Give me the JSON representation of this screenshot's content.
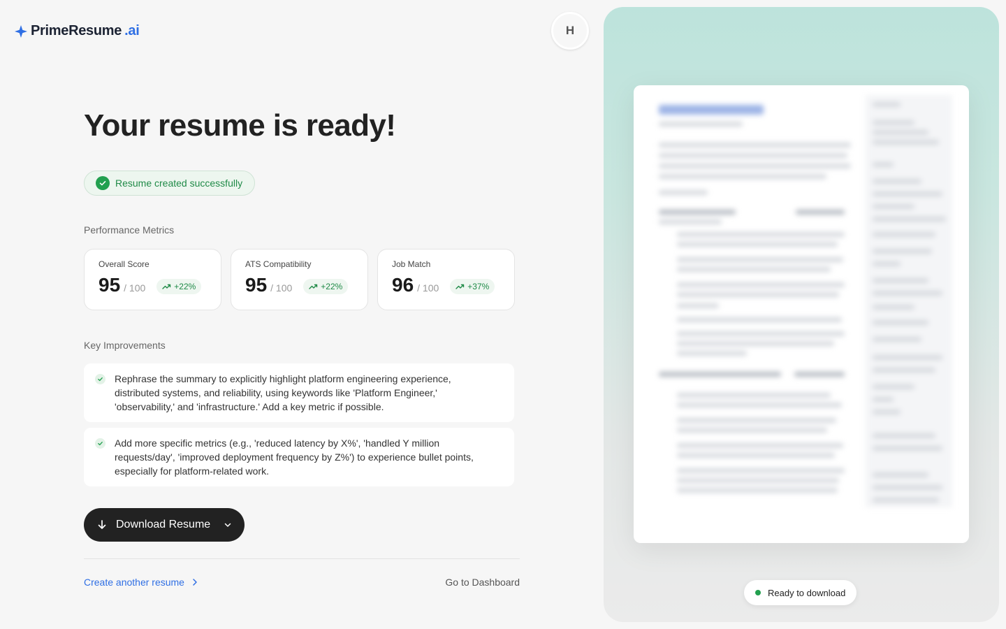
{
  "brand": {
    "name_main": "PrimeResume",
    "name_suffix": ".ai",
    "accent": "#2f6fe4"
  },
  "user": {
    "initial": "H"
  },
  "headline": "Your resume is ready!",
  "status": {
    "message": "Resume created successfully",
    "color": "#1f8a47"
  },
  "metrics_section": {
    "label": "Performance Metrics",
    "items": [
      {
        "name": "Overall Score",
        "value": "95",
        "max": "/ 100",
        "delta": "+22%"
      },
      {
        "name": "ATS Compatibility",
        "value": "95",
        "max": "/ 100",
        "delta": "+22%"
      },
      {
        "name": "Job Match",
        "value": "96",
        "max": "/ 100",
        "delta": "+37%"
      }
    ]
  },
  "improvements_section": {
    "label": "Key Improvements",
    "items": [
      "Rephrase the summary to explicitly highlight platform engineering experience, distributed systems, and reliability, using keywords like 'Platform Engineer,' 'observability,' and 'infrastructure.' Add a key metric if possible.",
      "Add more specific metrics (e.g., 'reduced latency by X%', 'handled Y million requests/day', 'improved deployment frequency by Z%') to experience bullet points, especially for platform-related work."
    ]
  },
  "actions": {
    "download_label": "Download Resume",
    "create_another": "Create another resume",
    "dashboard": "Go to Dashboard"
  },
  "preview": {
    "status_label": "Ready to download"
  },
  "icons": [
    "sparkle-logo-icon",
    "check-icon",
    "trend-up-icon",
    "arrow-down-icon",
    "chevron-down-icon",
    "chevron-right-icon"
  ]
}
